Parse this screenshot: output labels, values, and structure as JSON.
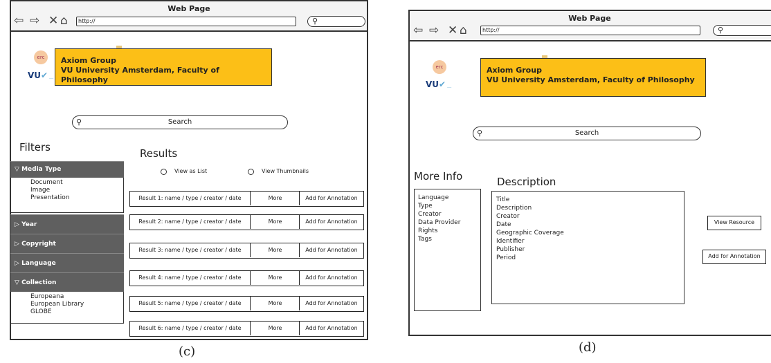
{
  "left": {
    "window_title": "Web Page",
    "url": "http://",
    "banner_line1": "Axiom Group",
    "banner_line2": "VU University Amsterdam, Faculty of Philosophy",
    "logo_erc": "erc",
    "logo_vu": "VU",
    "search_label": "Search",
    "filters_title": "Filters",
    "filter_media_type": "Media Type",
    "media_items": [
      "Document",
      "Image",
      "Presentation"
    ],
    "filter_year": "Year",
    "filter_copyright": "Copyright",
    "filter_language": "Language",
    "filter_collection": "Collection",
    "collection_items": [
      "Europeana",
      "European Library",
      "GLOBE"
    ],
    "results_title": "Results",
    "view_list": "View as List",
    "view_thumbs": "View Thumbnails",
    "results": [
      {
        "label": "Result 1: name / type / creator / date",
        "more": "More",
        "add": "Add for Annotation"
      },
      {
        "label": "Result 2: name / type / creator / date",
        "more": "More",
        "add": "Add for Annotation"
      },
      {
        "label": "Result 3: name / type / creator / date",
        "more": "More",
        "add": "Add for Annotation"
      },
      {
        "label": "Result 4: name / type / creator / date",
        "more": "More",
        "add": "Add for Annotation"
      },
      {
        "label": "Result 5: name / type / creator / date",
        "more": "More",
        "add": "Add for Annotation"
      },
      {
        "label": "Result 6: name / type / creator / date",
        "more": "More",
        "add": "Add for Annotation"
      }
    ],
    "caption": "(c)"
  },
  "right": {
    "window_title": "Web Page",
    "url": "http://",
    "banner_line1": "Axiom Group",
    "banner_line2": "VU University Amsterdam, Faculty of Philosophy",
    "logo_erc": "erc",
    "logo_vu": "VU",
    "search_label": "Search",
    "more_info_title": "More Info",
    "more_info_items": [
      "Language",
      "Type",
      "Creator",
      "Data Provider",
      "Rights",
      "Tags"
    ],
    "description_title": "Description",
    "description_items": [
      "Title",
      "Description",
      "Creator",
      "Date",
      "Geographic Coverage",
      "Identifier",
      "Publisher",
      "Period"
    ],
    "view_resource": "View Resource",
    "add_annotation": "Add for Annotation",
    "caption": "(d)"
  }
}
